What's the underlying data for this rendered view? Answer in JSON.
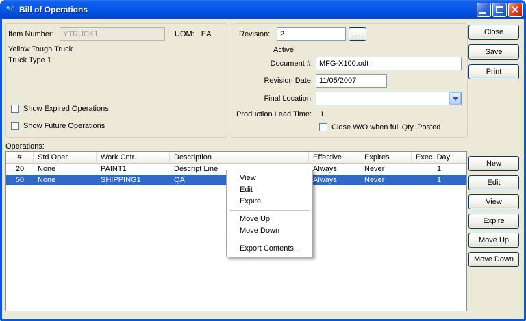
{
  "colors": {
    "titlebar": "#0855dd",
    "selection": "#316ac5",
    "background": "#ece9d8"
  },
  "window": {
    "title": "Bill of Operations"
  },
  "item": {
    "item_number_label": "Item Number:",
    "item_number_value": "YTRUCK1",
    "uom_label": "UOM:",
    "uom_value": "EA",
    "description_line1": "Yellow Tough Truck",
    "description_line2": "Truck Type 1",
    "show_expired_label": "Show Expired Operations",
    "show_future_label": "Show Future Operations"
  },
  "revision": {
    "revision_label": "Revision:",
    "revision_value": "2",
    "browse_button_label": "...",
    "status_text": "Active",
    "document_label": "Document #:",
    "document_value": "MFG-X100.odt",
    "revision_date_label": "Revision Date:",
    "revision_date_value": "11/05/2007",
    "final_location_label": "Final Location:",
    "final_location_value": "",
    "lead_time_label": "Production Lead Time:",
    "lead_time_value": "1",
    "close_wo_label": "Close W/O when full Qty. Posted"
  },
  "actions": {
    "close_label": "Close",
    "save_label": "Save",
    "print_label": "Print"
  },
  "operations": {
    "section_label": "Operations:",
    "columns": [
      "#",
      "Std Oper.",
      "Work Cntr.",
      "Description",
      "Effective",
      "Expires",
      "Exec. Day"
    ],
    "rows": [
      {
        "num": "20",
        "std_oper": "None",
        "work_cntr": "PAINT1",
        "description": "Descript Line",
        "effective": "Always",
        "expires": "Never",
        "exec_day": "1"
      },
      {
        "num": "50",
        "std_oper": "None",
        "work_cntr": "SHIPPING1",
        "description": "QA",
        "effective": "Always",
        "expires": "Never",
        "exec_day": "1"
      }
    ],
    "selected_row_index": 1,
    "buttons": {
      "new_label": "New",
      "edit_label": "Edit",
      "view_label": "View",
      "expire_label": "Expire",
      "move_up_label": "Move Up",
      "move_down_label": "Move Down"
    }
  },
  "context_menu": {
    "items": [
      {
        "type": "item",
        "label": "View"
      },
      {
        "type": "item",
        "label": "Edit"
      },
      {
        "type": "item",
        "label": "Expire"
      },
      {
        "type": "separator"
      },
      {
        "type": "item",
        "label": "Move Up"
      },
      {
        "type": "item",
        "label": "Move Down"
      },
      {
        "type": "separator"
      },
      {
        "type": "item",
        "label": "Export Contents..."
      }
    ]
  }
}
